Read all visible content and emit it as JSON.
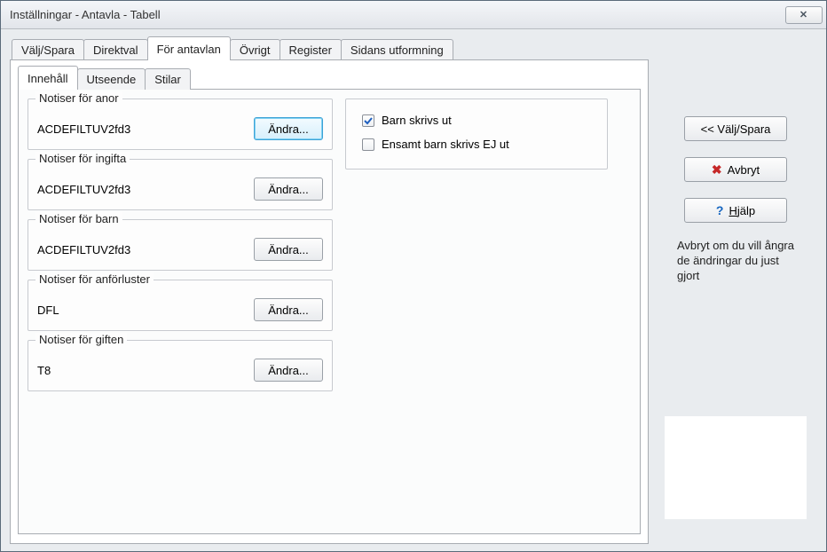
{
  "title": "Inställningar - Antavla - Tabell",
  "close_icon": "✕",
  "main_tabs": [
    "Välj/Spara",
    "Direktval",
    "För antavlan",
    "Övrigt",
    "Register",
    "Sidans utformning"
  ],
  "main_selected": 2,
  "sub_tabs": [
    "Innehåll",
    "Utseende",
    "Stilar"
  ],
  "sub_selected": 0,
  "groups": [
    {
      "legend": "Notiser för anor",
      "value": "ACDEFILTUV2fd3",
      "button": "Ändra...",
      "focused": true
    },
    {
      "legend": "Notiser för ingifta",
      "value": "ACDEFILTUV2fd3",
      "button": "Ändra...",
      "focused": false
    },
    {
      "legend": "Notiser för barn",
      "value": "ACDEFILTUV2fd3",
      "button": "Ändra...",
      "focused": false
    },
    {
      "legend": "Notiser för anförluster",
      "value": "DFL",
      "button": "Ändra...",
      "focused": false
    },
    {
      "legend": "Notiser för giften",
      "value": "T8",
      "button": "Ändra...",
      "focused": false
    }
  ],
  "checks": [
    {
      "label": "Barn skrivs ut",
      "checked": true
    },
    {
      "label": "Ensamt barn skrivs EJ ut",
      "checked": false
    }
  ],
  "side": {
    "back_label": "<< Välj/Spara",
    "cancel_label": "Avbryt",
    "help_label": "Hjälp",
    "help_prefix": "H",
    "help_rest": "jälp",
    "info_text": "Avbryt om du vill ångra de ändringar du just gjort"
  }
}
